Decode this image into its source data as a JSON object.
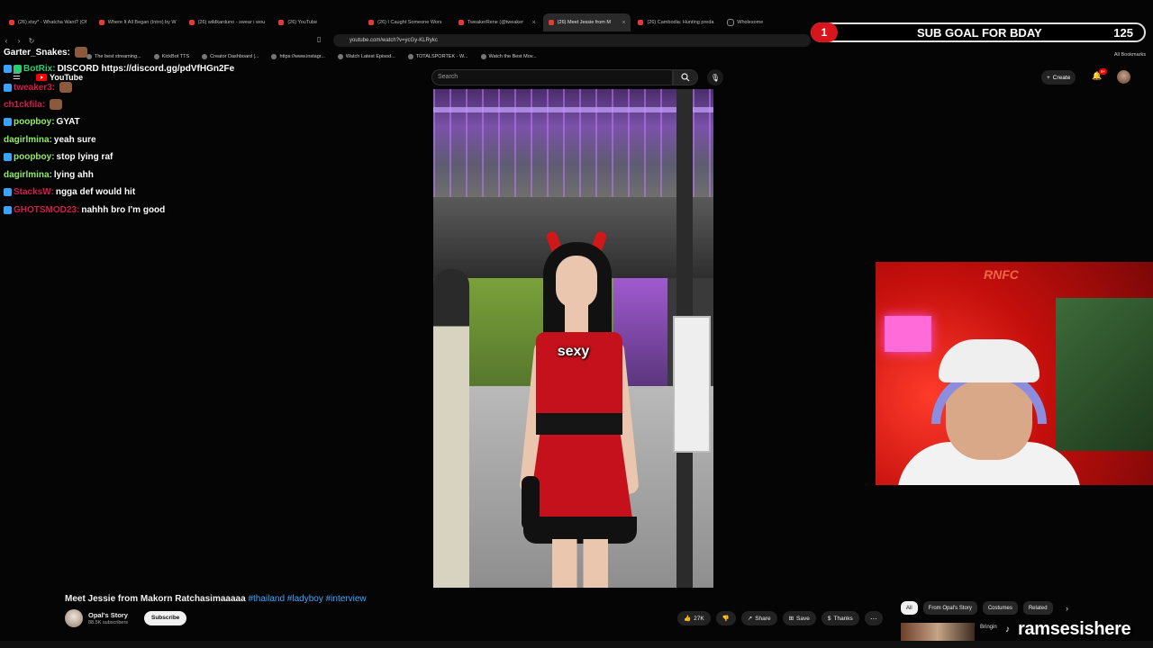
{
  "browser": {
    "tabs": [
      {
        "label": "(26) xtsy* - Whatcha Want? (Of"
      },
      {
        "label": "Where It All Began (Intro) by W"
      },
      {
        "label": "(26) wildkarduno - swear i wou"
      },
      {
        "label": "(26) YouTube"
      },
      {
        "label": "(26) I Caught Someone Wors"
      },
      {
        "label": "TweakerRene (@tweaker"
      },
      {
        "label": "(26) Meet Jessie from M"
      },
      {
        "label": "(26) Cambodia: Hunting preda"
      },
      {
        "label": "Wholesome"
      }
    ],
    "active_tab_index": 6,
    "url": "youtube.com/watch?v=ycGy-KLRykc",
    "bookmarks": [
      "The best streaming...",
      "KickBot TTS",
      "Creator Dashboard |...",
      "https://www.instagr...",
      "Watch Latest Episod...",
      "TOTALSPORTEK - W...",
      "Watch the Best Mov..."
    ],
    "all_bookmarks": "All Bookmarks"
  },
  "youtube": {
    "logo_text": "YouTube",
    "search_placeholder": "Search",
    "create_label": "Create",
    "notifications_badge": "9+"
  },
  "chat": {
    "messages": [
      {
        "user": "Garter_Snakes:",
        "text": "",
        "color": "#ffffff"
      },
      {
        "user": "BotRix:",
        "text": "DISCORD https://discord.gg/pdVfHGn2Fe",
        "color": "#2ecc71"
      },
      {
        "user": "tweaker3:",
        "text": "",
        "color": "#d21c4e"
      },
      {
        "user": "ch1ckfila:",
        "text": "",
        "color": "#d21c4e"
      },
      {
        "user": "poopboy:",
        "text": "GYAT",
        "color": "#8fef61"
      },
      {
        "user": "dagirlmina:",
        "text": "yeah sure",
        "color": "#8fef61"
      },
      {
        "user": "poopboy:",
        "text": "stop lying raf",
        "color": "#8fef61"
      },
      {
        "user": "dagirlmina:",
        "text": "lying ahh",
        "color": "#8fef61"
      },
      {
        "user": "StacksW:",
        "text": "ngga def would hit",
        "color": "#d21c4e"
      },
      {
        "user": "GHOTSMOD23:",
        "text": "nahhh bro I'm good",
        "color": "#d21c4e"
      }
    ]
  },
  "video": {
    "caption": "sexy",
    "title": "Meet Jessie from Makorn Ratchasimaaaaa",
    "tags": "#thailand #ladyboy #interview",
    "channel_name": "Opal's Story",
    "channel_subs": "88.5K subscribers",
    "subscribe_label": "Subscribe",
    "likes": "27K",
    "share_label": "Share",
    "save_label": "Save",
    "thanks_label": "Thanks"
  },
  "related_chips": [
    "All",
    "From Opal's Story",
    "Costumes",
    "Related"
  ],
  "recommendation_text": "Bringin",
  "overlay": {
    "sub_goal_count": "1",
    "sub_goal_label": "SUB GOAL FOR BDAY",
    "sub_goal_target": "125",
    "watermark": "ramsesishere",
    "webcam_logo": "RNFC"
  },
  "colors": {
    "youtube_red": "#ff0000",
    "subgoal_red": "#d6151c",
    "link_blue": "#3ea6ff"
  }
}
